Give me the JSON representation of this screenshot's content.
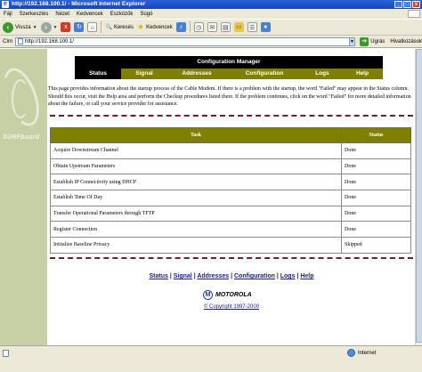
{
  "window": {
    "title": "http://192.168.100.1/ - Microsoft Internet Explorer"
  },
  "menu": [
    "Fájl",
    "Szerkesztés",
    "Nézet",
    "Kedvencek",
    "Eszközök",
    "Súgó"
  ],
  "toolbar": {
    "back_label": "Vissza",
    "search_label": "Keresés",
    "favorites_label": "Kedvencek"
  },
  "address": {
    "label": "Cím",
    "value": "http://192.168.100.1/",
    "go_label": "Ugrás",
    "links_label": "Hivatkozások"
  },
  "sidebar": {
    "logo_text": "SURFboard"
  },
  "header": {
    "title": "Configuration Manager"
  },
  "tabs": [
    {
      "label": "Status",
      "active": true
    },
    {
      "label": "Signal",
      "active": false
    },
    {
      "label": "Addresses",
      "active": false
    },
    {
      "label": "Configuration",
      "active": false
    },
    {
      "label": "Logs",
      "active": false
    },
    {
      "label": "Help",
      "active": false
    }
  ],
  "intro": "This page provides information about the startup process of the Cable Modem. If there is a problem with the startup, the word \"Failed\" may appear in the Status column. Should this occur, visit the Help area and perform the Checkup procedures listed there. If the problem continues, click on the word \"Failed\" for more detailed information about the failure, or call your service provider for assistance.",
  "table": {
    "columns": [
      "Task",
      "Status"
    ],
    "rows": [
      {
        "task": "Acquire Downstream Channel",
        "status": "Done"
      },
      {
        "task": "Obtain Upstream Parameters",
        "status": "Done"
      },
      {
        "task": "Establish IP Connectivity using DHCP",
        "status": "Done"
      },
      {
        "task": "Establish Time Of Day",
        "status": "Done"
      },
      {
        "task": "Transfer Operational Parameters through TFTP",
        "status": "Done"
      },
      {
        "task": "Register Connection",
        "status": "Done"
      },
      {
        "task": "Initialize Baseline Privacy",
        "status": "Skipped"
      }
    ]
  },
  "footer": {
    "links": [
      "Status",
      "Signal",
      "Addresses",
      "Configuration",
      "Logs",
      "Help"
    ],
    "separator": " | ",
    "brand": "MOTOROLA",
    "copyright": "© Copyright 1997-2000"
  },
  "status": {
    "zone": "Internet"
  },
  "colors": {
    "olive": "#808000",
    "sidebar": "#c6d0a4",
    "divider": "#7a1a2e",
    "link": "#1a1a8c"
  }
}
